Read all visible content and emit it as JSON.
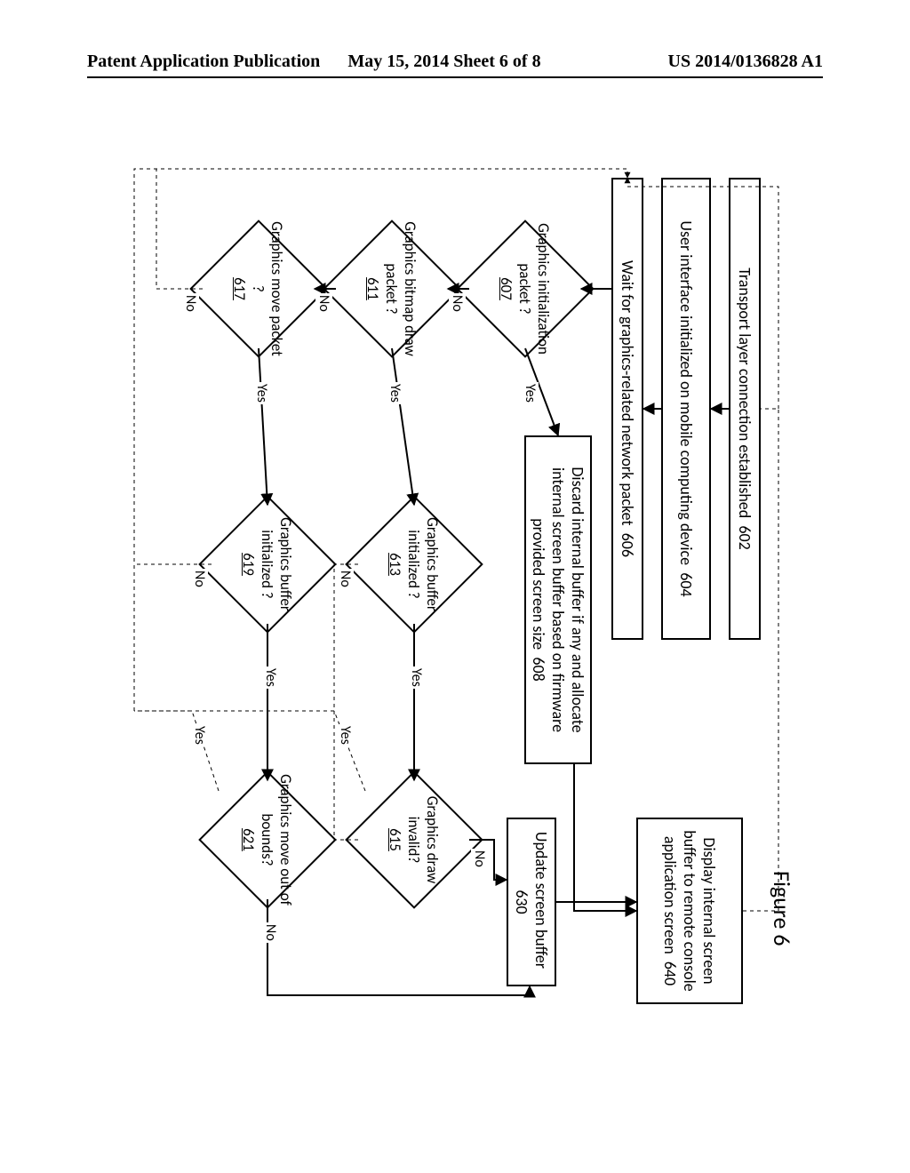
{
  "header": {
    "left": "Patent Application Publication",
    "center": "May 15, 2014  Sheet 6 of 8",
    "right": "US 2014/0136828 A1"
  },
  "figure_title": "Figure 6",
  "boxes": {
    "b602": {
      "text": "Transport layer connection established",
      "ref": "602"
    },
    "b604": {
      "text": "User interface initialized on mobile computing device",
      "ref": "604"
    },
    "b606": {
      "text": "Wait for graphics-related network packet",
      "ref": "606"
    },
    "b608": {
      "text": "Discard internal buffer if any and allocate internal screen buffer based on firmware provided screen size",
      "ref": "608"
    },
    "b630": {
      "text": "Update screen buffer",
      "ref": "630"
    },
    "b640": {
      "text": "Display internal screen buffer to remote console application screen",
      "ref": "640"
    }
  },
  "diamonds": {
    "d607": {
      "text": "Graphics initialization packet ?",
      "ref": "607"
    },
    "d611": {
      "text": "Graphics bitmap draw packet ?",
      "ref": "611"
    },
    "d617": {
      "text": "Graphics move packet ?",
      "ref": "617"
    },
    "d613": {
      "text": "Graphics buffer initialized ?",
      "ref": "613"
    },
    "d619": {
      "text": "Graphics buffer initialized ?",
      "ref": "619"
    },
    "d615": {
      "text": "Graphics draw invalid?",
      "ref": "615"
    },
    "d621": {
      "text": "Graphics move out of bounds?",
      "ref": "621"
    }
  },
  "edge_labels": {
    "yes": "Yes",
    "no": "No"
  },
  "chart_data": {
    "type": "flowchart",
    "title": "Figure 6",
    "nodes": [
      {
        "id": "602",
        "kind": "process",
        "label": "Transport layer connection established 602"
      },
      {
        "id": "604",
        "kind": "process",
        "label": "User interface initialized on mobile computing device 604"
      },
      {
        "id": "606",
        "kind": "process",
        "label": "Wait for graphics-related network packet 606"
      },
      {
        "id": "607",
        "kind": "decision",
        "label": "Graphics initialization packet ? 607"
      },
      {
        "id": "611",
        "kind": "decision",
        "label": "Graphics bitmap draw packet ? 611"
      },
      {
        "id": "617",
        "kind": "decision",
        "label": "Graphics move packet ? 617"
      },
      {
        "id": "608",
        "kind": "process",
        "label": "Discard internal buffer if any and allocate internal screen buffer based on firmware provided screen size 608"
      },
      {
        "id": "613",
        "kind": "decision",
        "label": "Graphics buffer initialized ? 613"
      },
      {
        "id": "619",
        "kind": "decision",
        "label": "Graphics buffer initialized ? 619"
      },
      {
        "id": "615",
        "kind": "decision",
        "label": "Graphics draw invalid? 615"
      },
      {
        "id": "621",
        "kind": "decision",
        "label": "Graphics move out of bounds? 621"
      },
      {
        "id": "630",
        "kind": "process",
        "label": "Update screen buffer 630"
      },
      {
        "id": "640",
        "kind": "process",
        "label": "Display internal screen buffer to remote console application screen 640"
      }
    ],
    "edges": [
      {
        "from": "602",
        "to": "604"
      },
      {
        "from": "604",
        "to": "606"
      },
      {
        "from": "606",
        "to": "607"
      },
      {
        "from": "607",
        "to": "608",
        "label": "Yes"
      },
      {
        "from": "607",
        "to": "611",
        "label": "No"
      },
      {
        "from": "611",
        "to": "613",
        "label": "Yes"
      },
      {
        "from": "611",
        "to": "617",
        "label": "No"
      },
      {
        "from": "617",
        "to": "619",
        "label": "Yes"
      },
      {
        "from": "617",
        "to": "606",
        "label": "No",
        "note": "dashed feedback left"
      },
      {
        "from": "613",
        "to": "615",
        "label": "Yes"
      },
      {
        "from": "613",
        "to": "606",
        "label": "No",
        "note": "dashed feedback"
      },
      {
        "from": "619",
        "to": "621",
        "label": "Yes"
      },
      {
        "from": "619",
        "to": "606",
        "label": "No",
        "note": "dashed feedback"
      },
      {
        "from": "615",
        "to": "630",
        "label": "No"
      },
      {
        "from": "615",
        "to": "606",
        "label": "Yes",
        "note": "dashed feedback"
      },
      {
        "from": "621",
        "to": "630",
        "label": "No"
      },
      {
        "from": "621",
        "to": "606",
        "label": "Yes",
        "note": "dashed feedback"
      },
      {
        "from": "608",
        "to": "640"
      },
      {
        "from": "630",
        "to": "640"
      },
      {
        "from": "640",
        "to": "606",
        "note": "dashed feedback top"
      }
    ]
  }
}
